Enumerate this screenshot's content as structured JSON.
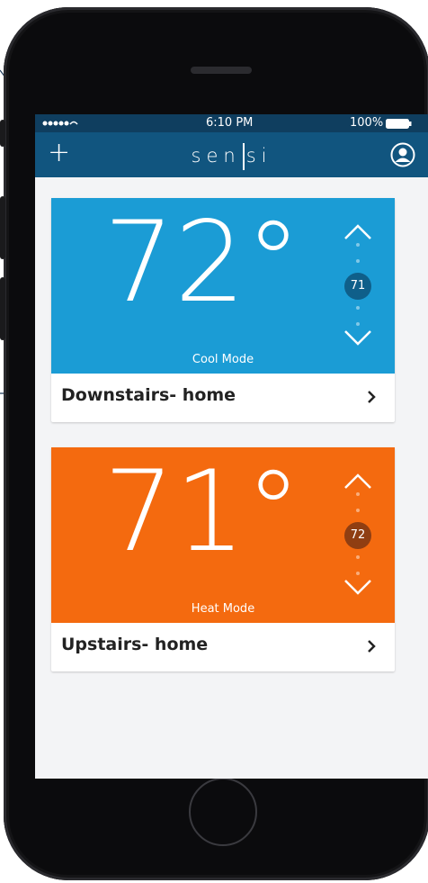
{
  "status_bar": {
    "time": "6:10 PM",
    "battery": "100%"
  },
  "nav": {
    "add_label": "+",
    "brand": [
      "sen",
      "si"
    ]
  },
  "thermostats": [
    {
      "temperature": "72°",
      "mode": "Cool Mode",
      "setpoint": "71",
      "name": "Downstairs- home",
      "color": "#1b9cd5",
      "setpoint_bg": "#0f5f8a"
    },
    {
      "temperature": "71°",
      "mode": "Heat Mode",
      "setpoint": "72",
      "name": "Upstairs- home",
      "color": "#f46a0f",
      "setpoint_bg": "#8f3e12"
    }
  ],
  "colors": {
    "status_bar": "#0f3e5f",
    "nav_bar": "#11557f",
    "screen_bg": "#f3f4f6",
    "callout": "#1d3a5a"
  }
}
